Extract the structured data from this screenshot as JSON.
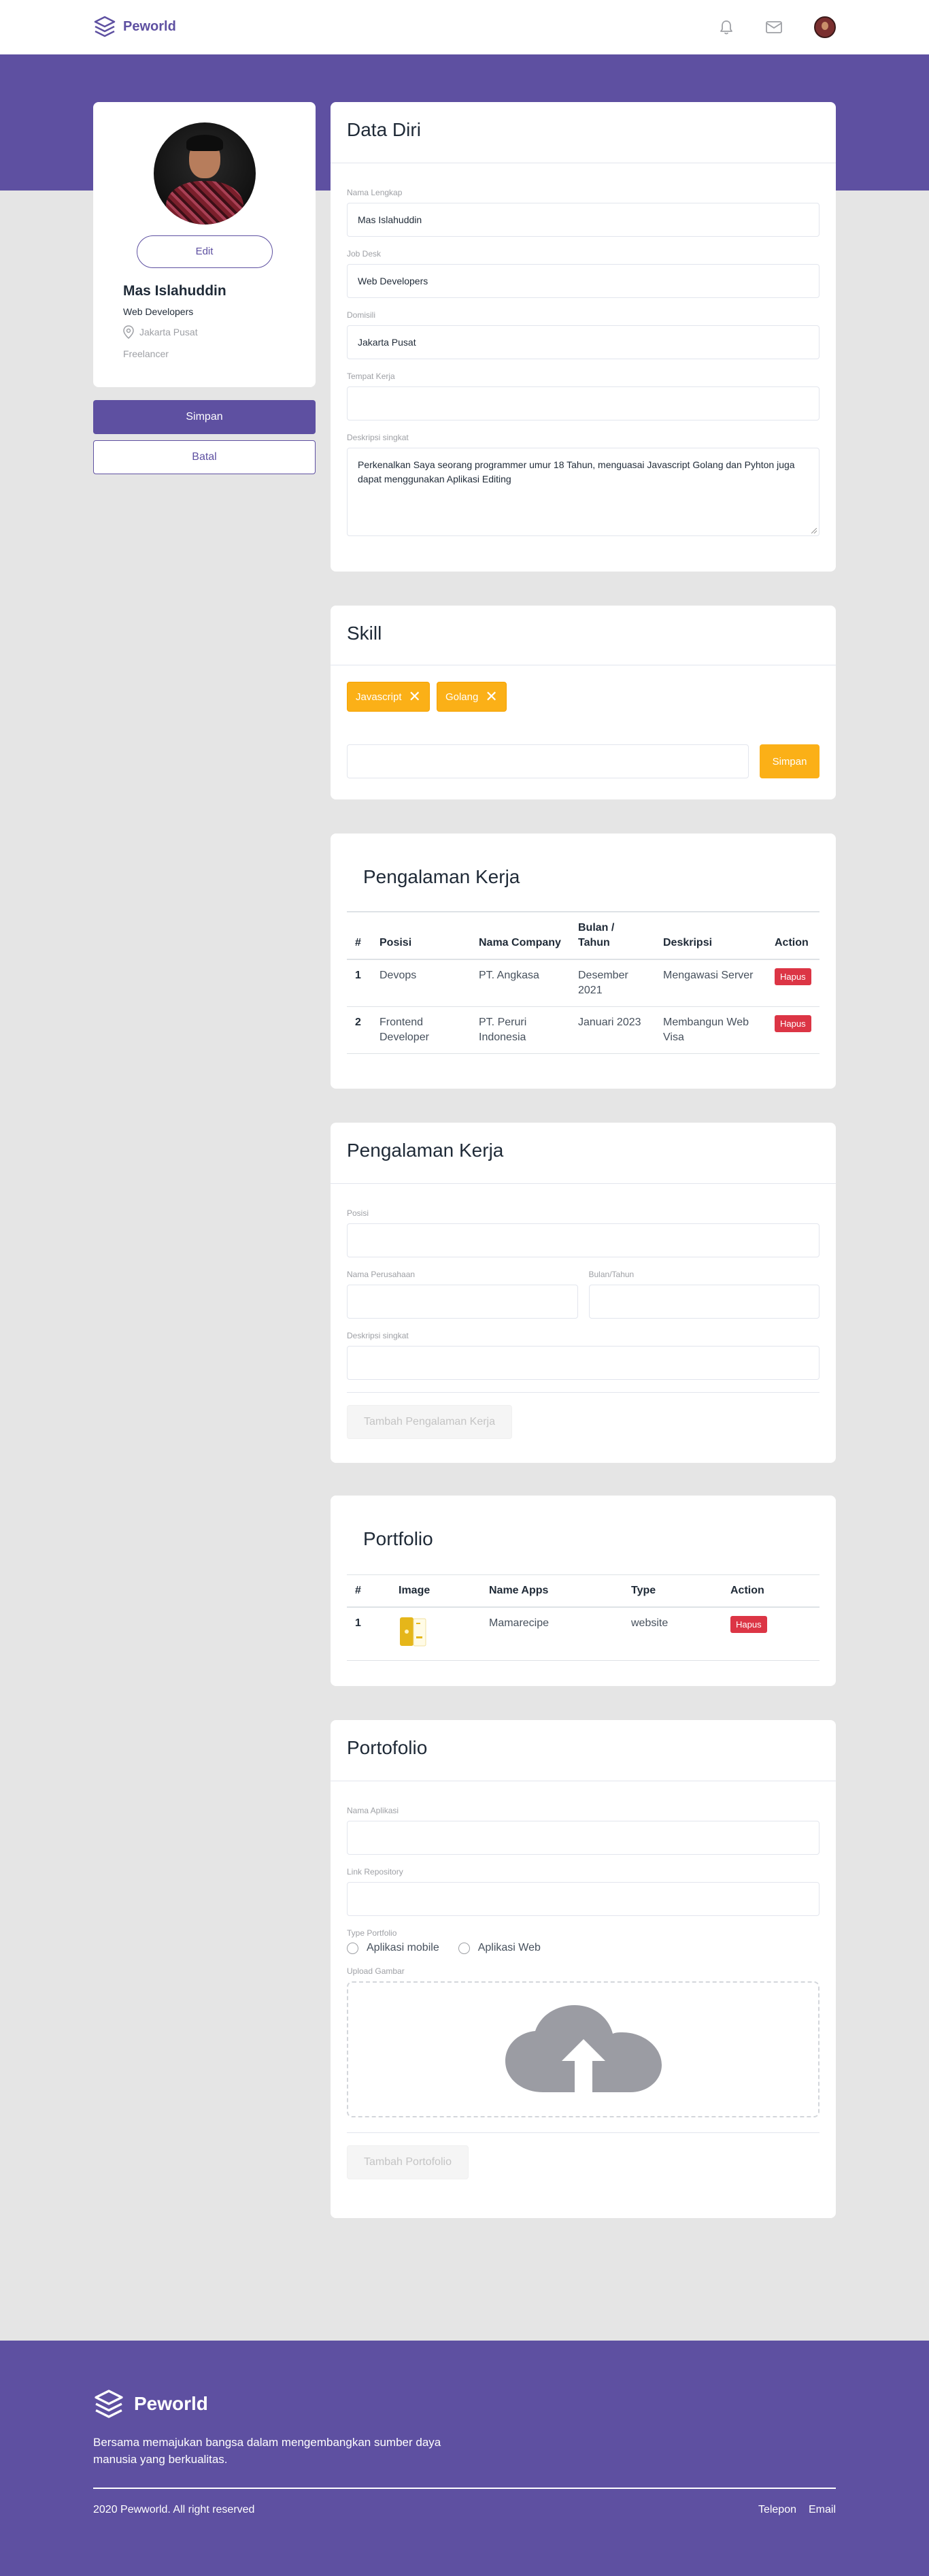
{
  "brand": {
    "name": "Peworld",
    "color": "#5e50a1"
  },
  "navbar": {
    "icons": [
      "bell-icon",
      "mail-icon",
      "avatar"
    ]
  },
  "profile": {
    "edit_label": "Edit",
    "name": "Mas Islahuddin",
    "job": "Web Developers",
    "location": "Jakarta Pusat",
    "work_type": "Freelancer"
  },
  "side_actions": {
    "save_label": "Simpan",
    "cancel_label": "Batal"
  },
  "data_diri": {
    "title": "Data Diri",
    "fields": [
      {
        "label": "Nama Lengkap",
        "value": "Mas Islahuddin"
      },
      {
        "label": "Job Desk",
        "value": "Web Developers"
      },
      {
        "label": "Domisili",
        "value": "Jakarta Pusat"
      },
      {
        "label": "Tempat Kerja",
        "value": ""
      }
    ],
    "description_label": "Deskripsi singkat",
    "description_value": "Perkenalkan Saya seorang programmer umur 18 Tahun, menguasai Javascript Golang dan Pyhton juga dapat menggunakan Aplikasi Editing"
  },
  "skill": {
    "title": "Skill",
    "chips": [
      "Javascript",
      "Golang"
    ],
    "input_value": "",
    "save_label": "Simpan",
    "accent": "#fbb017"
  },
  "experience_table": {
    "title": "Pengalaman Kerja",
    "headers": [
      "#",
      "Posisi",
      "Nama Company",
      "Bulan / Tahun",
      "Deskripsi",
      "Action"
    ],
    "rows": [
      {
        "no": "1",
        "posisi": "Devops",
        "company": "PT. Angkasa",
        "date": "Desember 2021",
        "desc": "Mengawasi Server",
        "action": "Hapus"
      },
      {
        "no": "2",
        "posisi": "Frontend Developer",
        "company": "PT. Peruri Indonesia",
        "date": "Januari 2023",
        "desc": "Membangun Web Visa",
        "action": "Hapus"
      }
    ]
  },
  "experience_form": {
    "title": "Pengalaman Kerja",
    "posisi_label": "Posisi",
    "company_label": "Nama Perusahaan",
    "date_label": "Bulan/Tahun",
    "desc_label": "Deskripsi singkat",
    "submit_label": "Tambah Pengalaman Kerja"
  },
  "portfolio_table": {
    "title": "Portfolio",
    "headers": [
      "#",
      "Image",
      "Name Apps",
      "Type",
      "Action"
    ],
    "rows": [
      {
        "no": "1",
        "image_icon": "app-thumbnail-icon",
        "name": "Mamarecipe",
        "type": "website",
        "action": "Hapus"
      }
    ]
  },
  "portfolio_form": {
    "title": "Portofolio",
    "app_name_label": "Nama Aplikasi",
    "repo_label": "Link Repository",
    "type_label": "Type Portfolio",
    "type_options": [
      "Aplikasi mobile",
      "Aplikasi Web"
    ],
    "upload_label": "Upload Gambar",
    "submit_label": "Tambah Portofolio"
  },
  "footer": {
    "brand": "Peworld",
    "description": "Bersama memajukan bangsa dalam mengembangkan sumber daya manusia yang berkualitas.",
    "copyright": "2020 Pewworld. All right reserved",
    "links": [
      "Telepon",
      "Email"
    ]
  }
}
